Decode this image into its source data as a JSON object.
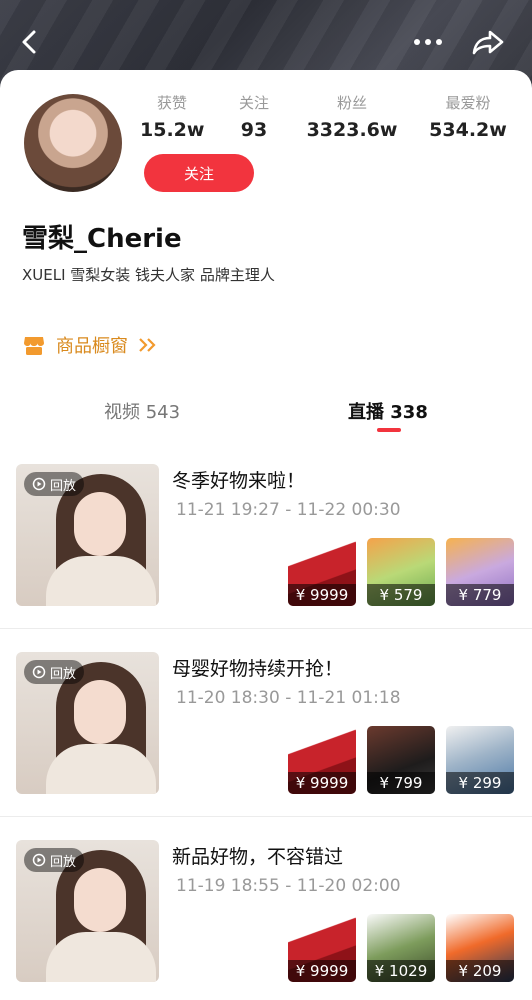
{
  "profile": {
    "stats": [
      {
        "label": "获赞",
        "value": "15.2w"
      },
      {
        "label": "关注",
        "value": "93"
      },
      {
        "label": "粉丝",
        "value": "3323.6w"
      },
      {
        "label": "最爱粉",
        "value": "534.2w"
      }
    ],
    "follow_label": "关注",
    "name": "雪梨_Cherie",
    "bio": "XUELI 雪梨女装 钱夫人家 品牌主理人"
  },
  "showcase": {
    "label": "商品橱窗"
  },
  "tabs": [
    {
      "label": "视频 543",
      "active": false
    },
    {
      "label": "直播 338",
      "active": true
    }
  ],
  "streams": [
    {
      "replay": "回放",
      "title": "冬季好物来啦！",
      "time": "11-21 19:27 - 11-22 00:30",
      "products": [
        {
          "price": "¥ 9999"
        },
        {
          "price": "¥ 579"
        },
        {
          "price": "¥ 779"
        }
      ]
    },
    {
      "replay": "回放",
      "title": "母婴好物持续开抢！",
      "time": "11-20 18:30 - 11-21 01:18",
      "products": [
        {
          "price": "¥ 9999"
        },
        {
          "price": "¥ 799"
        },
        {
          "price": "¥ 299"
        }
      ]
    },
    {
      "replay": "回放",
      "title": "新品好物，不容错过",
      "time": "11-19 18:55 - 11-20 02:00",
      "products": [
        {
          "price": "¥ 9999"
        },
        {
          "price": "¥ 1029"
        },
        {
          "price": "¥ 209"
        }
      ]
    }
  ],
  "colors": {
    "accent": "#f2343e",
    "showcase": "#d98a1e"
  },
  "icons": [
    "back-icon",
    "more-icon",
    "share-icon",
    "shop-icon",
    "double-chevron-icon",
    "replay-icon"
  ]
}
